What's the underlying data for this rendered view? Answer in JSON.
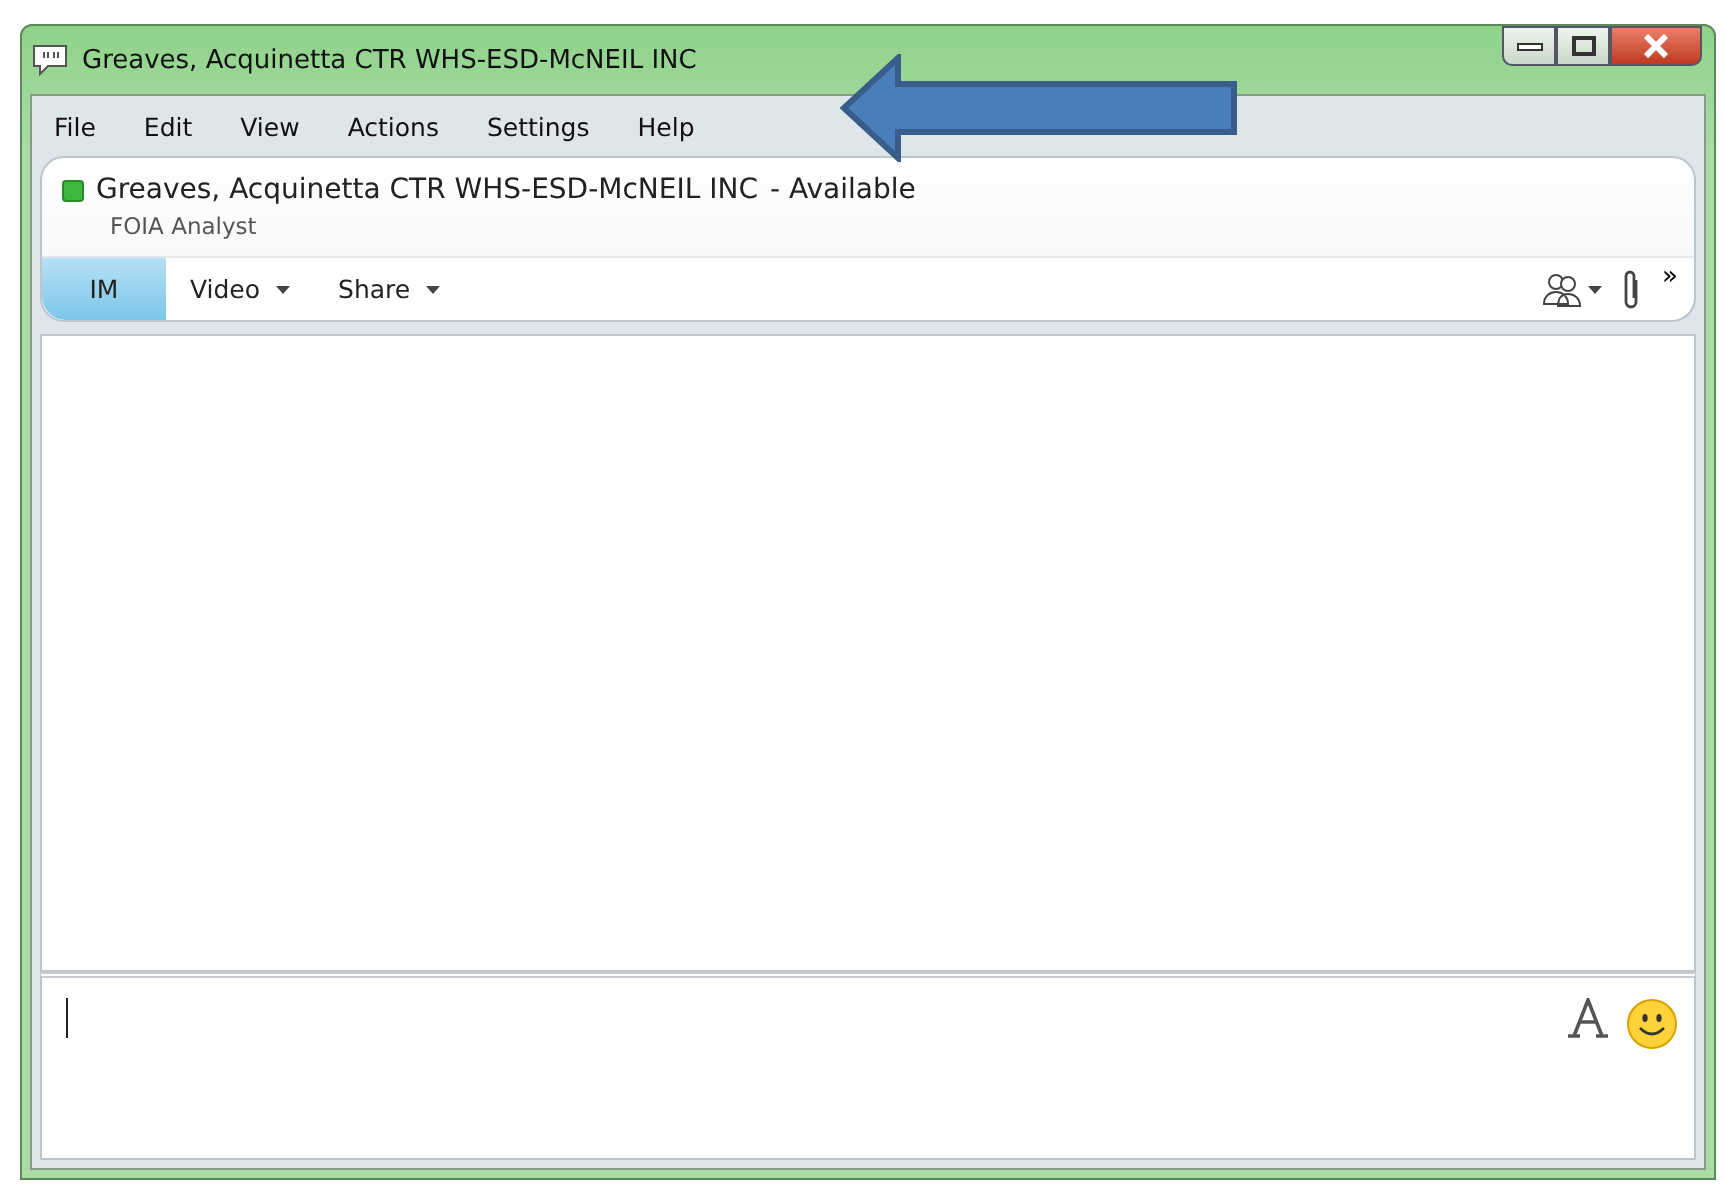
{
  "window": {
    "title": "Greaves, Acquinetta CTR WHS-ESD-McNEIL INC"
  },
  "menu": [
    "File",
    "Edit",
    "View",
    "Actions",
    "Settings",
    "Help"
  ],
  "contact": {
    "name": "Greaves, Acquinetta CTR WHS-ESD-McNEIL INC",
    "status": "- Available",
    "online": true,
    "title": "FOIA Analyst"
  },
  "tabs": [
    {
      "label": "IM",
      "selected": true,
      "dropdown": false
    },
    {
      "label": "Video",
      "selected": false,
      "dropdown": true
    },
    {
      "label": "Share",
      "selected": false,
      "dropdown": true
    }
  ],
  "overflow": "»"
}
